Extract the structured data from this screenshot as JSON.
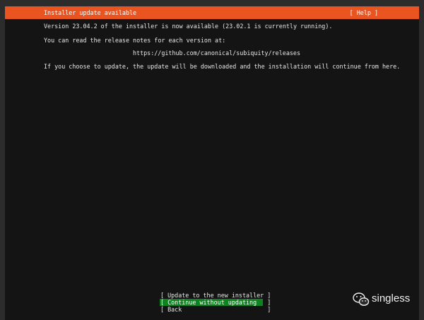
{
  "header": {
    "title": "Installer update available",
    "help": "[ Help ]"
  },
  "body": {
    "line1": "Version 23.04.2 of the installer is now available (23.02.1 is currently running).",
    "line2": "You can read the release notes for each version at:",
    "url": "https://github.com/canonical/subiquity/releases",
    "line3": "If you choose to update, the update will be downloaded and the installation will continue from here."
  },
  "menu": {
    "update": "[ Update to the new installer ]",
    "continue": "[ Continue without updating   ]",
    "back": "[ Back                        ]"
  },
  "watermark": {
    "text": "singless"
  },
  "colors": {
    "accent": "#e95420",
    "selected": "#0e8420",
    "background": "#141414"
  }
}
